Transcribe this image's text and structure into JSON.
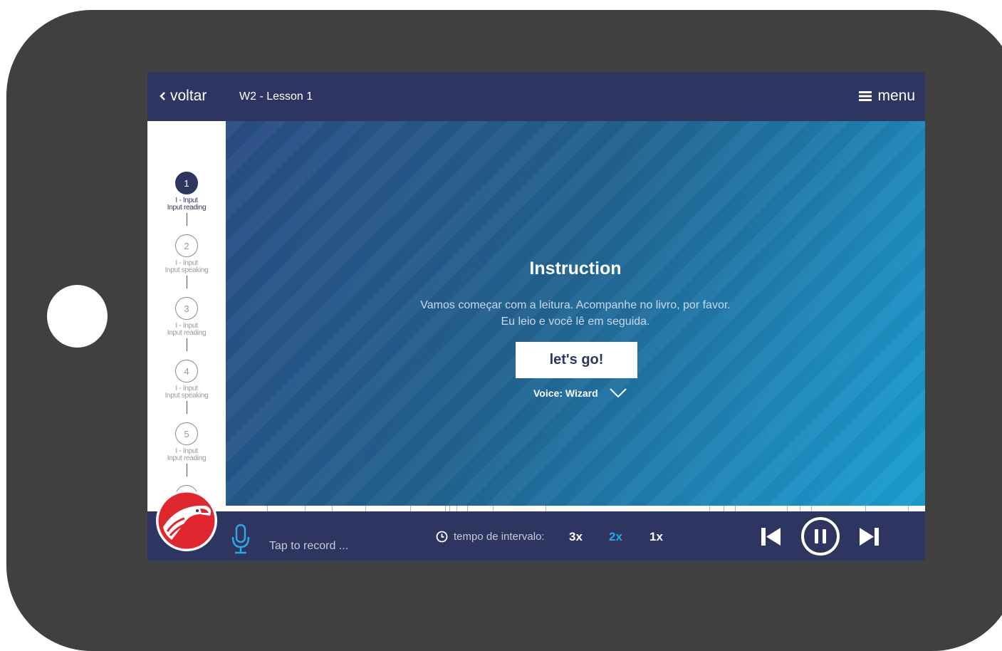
{
  "topbar": {
    "back_label": "voltar",
    "lesson_title": "W2 - Lesson 1",
    "menu_label": "menu"
  },
  "steps": [
    {
      "number": "1",
      "line1": "I - Input",
      "line2": "Input reading",
      "active": true
    },
    {
      "number": "2",
      "line1": "I - Input",
      "line2": "Input speaking",
      "active": false
    },
    {
      "number": "3",
      "line1": "I - Input",
      "line2": "Input reading",
      "active": false
    },
    {
      "number": "4",
      "line1": "I - Input",
      "line2": "Input speaking",
      "active": false
    },
    {
      "number": "5",
      "line1": "I - Input",
      "line2": "Input reading",
      "active": false
    }
  ],
  "instruction": {
    "title": "Instruction",
    "line1": "Vamos começar com a leitura. Acompanhe no livro, por favor.",
    "line2": "Eu leio e você lê em seguida.",
    "button_label": "let's go!",
    "voice_label": "Voice: Wizard"
  },
  "bottombar": {
    "record_label": "Tap to record ...",
    "interval_label": "tempo de intervalo:",
    "speeds": [
      {
        "label": "3x",
        "active": false
      },
      {
        "label": "2x",
        "active": true
      },
      {
        "label": "1x",
        "active": false
      }
    ]
  },
  "colors": {
    "navy": "#2e3560",
    "accent_blue": "#2aa8e0",
    "brand_red": "#e0262f",
    "device_frame": "#404040"
  }
}
